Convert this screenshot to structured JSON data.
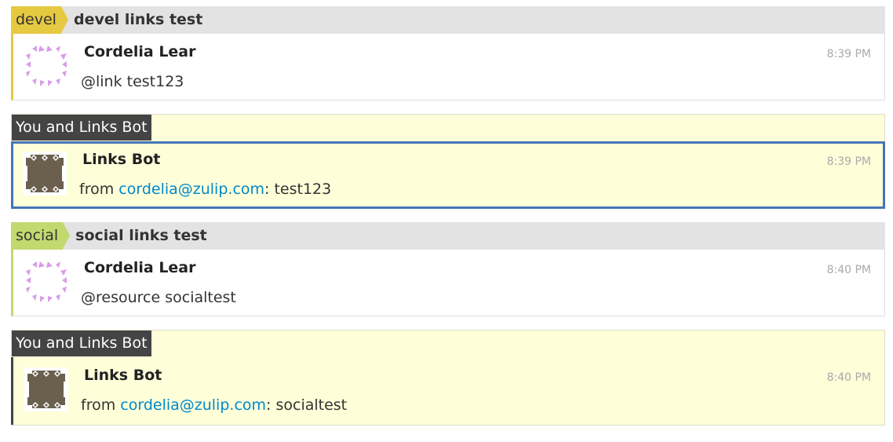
{
  "blocks": [
    {
      "kind": "stream",
      "stream": "devel",
      "stream_color": "#e5c940",
      "topic": "devel links test",
      "message": {
        "sender": "Cordelia Lear",
        "avatar_icon": "cordelia-avatar-icon",
        "content": "@link test123",
        "time": "8:39 PM"
      }
    },
    {
      "kind": "private",
      "recipients_label": "You and Links Bot",
      "message": {
        "sender": "Links Bot",
        "avatar_icon": "links-bot-avatar-icon",
        "content_prefix": "from ",
        "content_link": "cordelia@zulip.com",
        "content_suffix": ": test123",
        "time": "8:39 PM",
        "selected": true
      }
    },
    {
      "kind": "stream",
      "stream": "social",
      "stream_color": "#c2d96f",
      "topic": "social links test",
      "message": {
        "sender": "Cordelia Lear",
        "avatar_icon": "cordelia-avatar-icon",
        "content": "@resource socialtest",
        "time": "8:40 PM"
      }
    },
    {
      "kind": "private",
      "recipients_label": "You and Links Bot",
      "message": {
        "sender": "Links Bot",
        "avatar_icon": "links-bot-avatar-icon",
        "content_prefix": "from ",
        "content_link": "cordelia@zulip.com",
        "content_suffix": ": socialtest",
        "time": "8:40 PM",
        "selected": false
      }
    }
  ]
}
